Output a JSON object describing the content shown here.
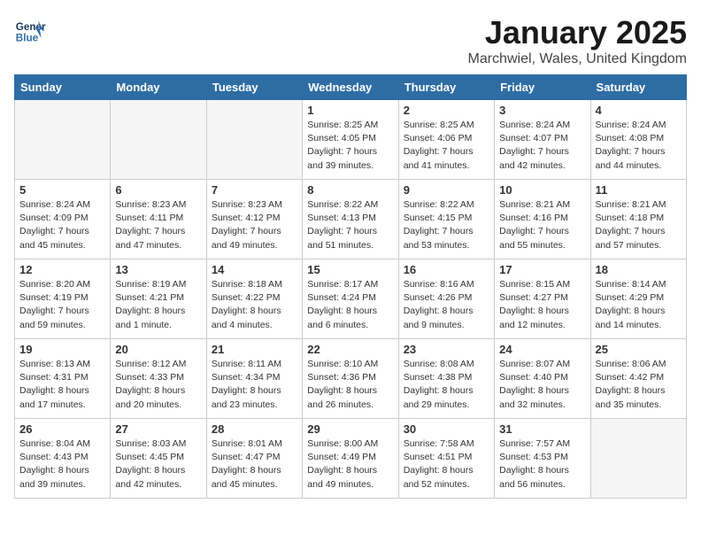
{
  "header": {
    "logo_line1": "General",
    "logo_line2": "Blue",
    "month_title": "January 2025",
    "location": "Marchwiel, Wales, United Kingdom"
  },
  "weekdays": [
    "Sunday",
    "Monday",
    "Tuesday",
    "Wednesday",
    "Thursday",
    "Friday",
    "Saturday"
  ],
  "weeks": [
    [
      {
        "day": "",
        "info": ""
      },
      {
        "day": "",
        "info": ""
      },
      {
        "day": "",
        "info": ""
      },
      {
        "day": "1",
        "info": "Sunrise: 8:25 AM\nSunset: 4:05 PM\nDaylight: 7 hours\nand 39 minutes."
      },
      {
        "day": "2",
        "info": "Sunrise: 8:25 AM\nSunset: 4:06 PM\nDaylight: 7 hours\nand 41 minutes."
      },
      {
        "day": "3",
        "info": "Sunrise: 8:24 AM\nSunset: 4:07 PM\nDaylight: 7 hours\nand 42 minutes."
      },
      {
        "day": "4",
        "info": "Sunrise: 8:24 AM\nSunset: 4:08 PM\nDaylight: 7 hours\nand 44 minutes."
      }
    ],
    [
      {
        "day": "5",
        "info": "Sunrise: 8:24 AM\nSunset: 4:09 PM\nDaylight: 7 hours\nand 45 minutes."
      },
      {
        "day": "6",
        "info": "Sunrise: 8:23 AM\nSunset: 4:11 PM\nDaylight: 7 hours\nand 47 minutes."
      },
      {
        "day": "7",
        "info": "Sunrise: 8:23 AM\nSunset: 4:12 PM\nDaylight: 7 hours\nand 49 minutes."
      },
      {
        "day": "8",
        "info": "Sunrise: 8:22 AM\nSunset: 4:13 PM\nDaylight: 7 hours\nand 51 minutes."
      },
      {
        "day": "9",
        "info": "Sunrise: 8:22 AM\nSunset: 4:15 PM\nDaylight: 7 hours\nand 53 minutes."
      },
      {
        "day": "10",
        "info": "Sunrise: 8:21 AM\nSunset: 4:16 PM\nDaylight: 7 hours\nand 55 minutes."
      },
      {
        "day": "11",
        "info": "Sunrise: 8:21 AM\nSunset: 4:18 PM\nDaylight: 7 hours\nand 57 minutes."
      }
    ],
    [
      {
        "day": "12",
        "info": "Sunrise: 8:20 AM\nSunset: 4:19 PM\nDaylight: 7 hours\nand 59 minutes."
      },
      {
        "day": "13",
        "info": "Sunrise: 8:19 AM\nSunset: 4:21 PM\nDaylight: 8 hours\nand 1 minute."
      },
      {
        "day": "14",
        "info": "Sunrise: 8:18 AM\nSunset: 4:22 PM\nDaylight: 8 hours\nand 4 minutes."
      },
      {
        "day": "15",
        "info": "Sunrise: 8:17 AM\nSunset: 4:24 PM\nDaylight: 8 hours\nand 6 minutes."
      },
      {
        "day": "16",
        "info": "Sunrise: 8:16 AM\nSunset: 4:26 PM\nDaylight: 8 hours\nand 9 minutes."
      },
      {
        "day": "17",
        "info": "Sunrise: 8:15 AM\nSunset: 4:27 PM\nDaylight: 8 hours\nand 12 minutes."
      },
      {
        "day": "18",
        "info": "Sunrise: 8:14 AM\nSunset: 4:29 PM\nDaylight: 8 hours\nand 14 minutes."
      }
    ],
    [
      {
        "day": "19",
        "info": "Sunrise: 8:13 AM\nSunset: 4:31 PM\nDaylight: 8 hours\nand 17 minutes."
      },
      {
        "day": "20",
        "info": "Sunrise: 8:12 AM\nSunset: 4:33 PM\nDaylight: 8 hours\nand 20 minutes."
      },
      {
        "day": "21",
        "info": "Sunrise: 8:11 AM\nSunset: 4:34 PM\nDaylight: 8 hours\nand 23 minutes."
      },
      {
        "day": "22",
        "info": "Sunrise: 8:10 AM\nSunset: 4:36 PM\nDaylight: 8 hours\nand 26 minutes."
      },
      {
        "day": "23",
        "info": "Sunrise: 8:08 AM\nSunset: 4:38 PM\nDaylight: 8 hours\nand 29 minutes."
      },
      {
        "day": "24",
        "info": "Sunrise: 8:07 AM\nSunset: 4:40 PM\nDaylight: 8 hours\nand 32 minutes."
      },
      {
        "day": "25",
        "info": "Sunrise: 8:06 AM\nSunset: 4:42 PM\nDaylight: 8 hours\nand 35 minutes."
      }
    ],
    [
      {
        "day": "26",
        "info": "Sunrise: 8:04 AM\nSunset: 4:43 PM\nDaylight: 8 hours\nand 39 minutes."
      },
      {
        "day": "27",
        "info": "Sunrise: 8:03 AM\nSunset: 4:45 PM\nDaylight: 8 hours\nand 42 minutes."
      },
      {
        "day": "28",
        "info": "Sunrise: 8:01 AM\nSunset: 4:47 PM\nDaylight: 8 hours\nand 45 minutes."
      },
      {
        "day": "29",
        "info": "Sunrise: 8:00 AM\nSunset: 4:49 PM\nDaylight: 8 hours\nand 49 minutes."
      },
      {
        "day": "30",
        "info": "Sunrise: 7:58 AM\nSunset: 4:51 PM\nDaylight: 8 hours\nand 52 minutes."
      },
      {
        "day": "31",
        "info": "Sunrise: 7:57 AM\nSunset: 4:53 PM\nDaylight: 8 hours\nand 56 minutes."
      },
      {
        "day": "",
        "info": ""
      }
    ]
  ]
}
